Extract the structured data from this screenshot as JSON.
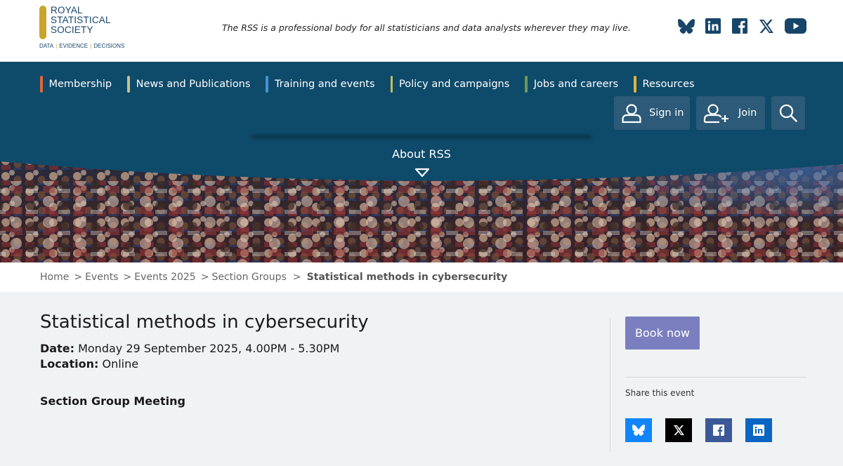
{
  "header": {
    "logo_lines": [
      "ROYAL",
      "STATISTICAL",
      "SOCIETY"
    ],
    "logo_tagline": [
      "DATA",
      "EVIDENCE",
      "DECISIONS"
    ],
    "tagline": "The RSS is a professional body for all statisticians and data analysts wherever they may live.",
    "social": [
      {
        "name": "Bluesky",
        "icon": "bluesky-icon"
      },
      {
        "name": "LinkedIn",
        "icon": "linkedin-icon"
      },
      {
        "name": "Facebook",
        "icon": "facebook-icon"
      },
      {
        "name": "X",
        "icon": "x-icon"
      },
      {
        "name": "YouTube",
        "icon": "youtube-icon"
      }
    ]
  },
  "nav": {
    "items": [
      {
        "label": "Membership",
        "color": "#e0673a"
      },
      {
        "label": "News and Publications",
        "color": "#c9c093"
      },
      {
        "label": "Training and events",
        "color": "#4c8fd6"
      },
      {
        "label": "Policy and campaigns",
        "color": "#c6bd55"
      },
      {
        "label": "Jobs and careers",
        "color": "#6f9a57"
      },
      {
        "label": "Resources",
        "color": "#e0b33a"
      }
    ],
    "sign_in": "Sign in",
    "join": "Join",
    "about": "About RSS"
  },
  "breadcrumb": {
    "items": [
      "Home",
      "Events",
      "Events 2025",
      "Section Groups"
    ],
    "current": "Statistical methods in cybersecurity"
  },
  "event": {
    "title": "Statistical methods in cybersecurity",
    "date_label": "Date:",
    "date_value": "Monday 29 September 2025, 4.00PM - 5.30PM",
    "location_label": "Location:",
    "location_value": "Online",
    "type": "Section Group Meeting"
  },
  "sidebar": {
    "book_label": "Book now",
    "share_label": "Share this event",
    "share": [
      {
        "icon": "bluesky-icon",
        "color": "#1185fe"
      },
      {
        "icon": "x-icon",
        "color": "#000000"
      },
      {
        "icon": "facebook-icon",
        "color": "#3b5998"
      },
      {
        "icon": "linkedin-icon",
        "color": "#0a66c2"
      }
    ]
  },
  "colors": {
    "brand_navy": "#17456a",
    "brand_gold": "#c8a52c",
    "nav_band": "#0e4a6a",
    "book_button": "#7b7fc0"
  }
}
